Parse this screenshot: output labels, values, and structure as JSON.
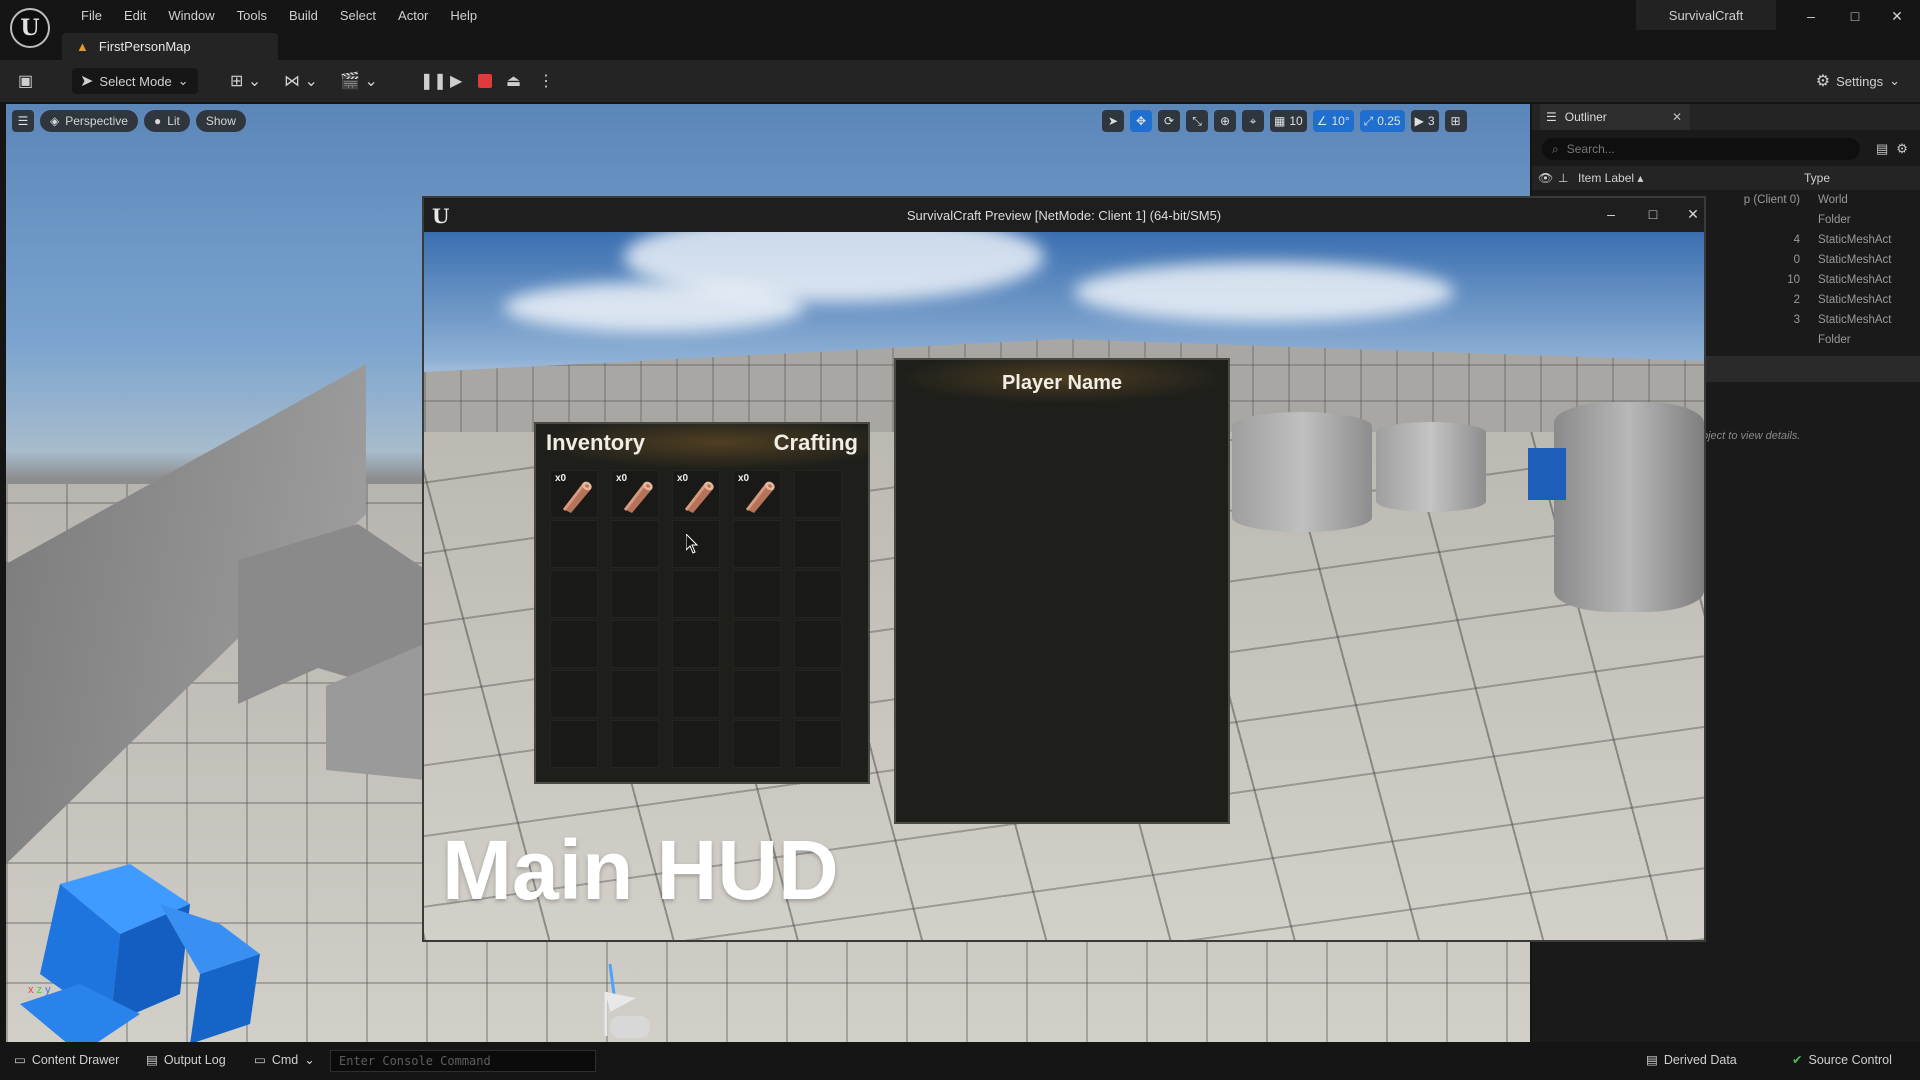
{
  "app": {
    "project_name": "SurvivalCraft",
    "menu": [
      "File",
      "Edit",
      "Window",
      "Tools",
      "Build",
      "Select",
      "Actor",
      "Help"
    ],
    "tab_label": "FirstPersonMap",
    "window_controls": [
      "–",
      "□",
      "✕"
    ]
  },
  "toolbar": {
    "select_mode_label": "Select Mode",
    "settings_label": "Settings"
  },
  "viewport": {
    "perspective_label": "Perspective",
    "lit_label": "Lit",
    "show_label": "Show",
    "grid_snap": "10",
    "rotation_snap": "10°",
    "scale_snap": "0.25",
    "camera_speed": "3"
  },
  "outliner": {
    "tab_label": "Outliner",
    "search_placeholder": "Search...",
    "col_label": "Item Label",
    "col_type": "Type",
    "rows": [
      {
        "label": "p (Client 0)",
        "type": "World"
      },
      {
        "label": "",
        "type": "Folder"
      },
      {
        "label": "4",
        "type": "StaticMeshAct"
      },
      {
        "label": "0",
        "type": "StaticMeshAct"
      },
      {
        "label": "10",
        "type": "StaticMeshAct"
      },
      {
        "label": "2",
        "type": "StaticMeshAct"
      },
      {
        "label": "3",
        "type": "StaticMeshAct"
      },
      {
        "label": "",
        "type": "Folder"
      }
    ],
    "details_hint": "bject to view details."
  },
  "statusbar": {
    "content_drawer": "Content Drawer",
    "output_log": "Output Log",
    "cmd": "Cmd",
    "console_placeholder": "Enter Console Command",
    "derived_data": "Derived Data",
    "source_control": "Source Control"
  },
  "pie": {
    "caption": "SurvivalCraft Preview [NetMode: Client 1]  (64-bit/SM5)",
    "inventory_title": "Inventory",
    "crafting_title": "Crafting",
    "player_name": "Player Name",
    "hud_label": "Main HUD",
    "slots": [
      {
        "qty": "x0",
        "item": "wood-log"
      },
      {
        "qty": "x0",
        "item": "wood-log"
      },
      {
        "qty": "x0",
        "item": "wood-log"
      },
      {
        "qty": "x0",
        "item": "wood-log"
      }
    ],
    "total_slots": 30
  },
  "colors": {
    "accent_blue": "#1f6fd0",
    "stop_red": "#e03a3a",
    "warning_orange": "#e09a2c",
    "panel_bg": "#1e1f1b"
  }
}
